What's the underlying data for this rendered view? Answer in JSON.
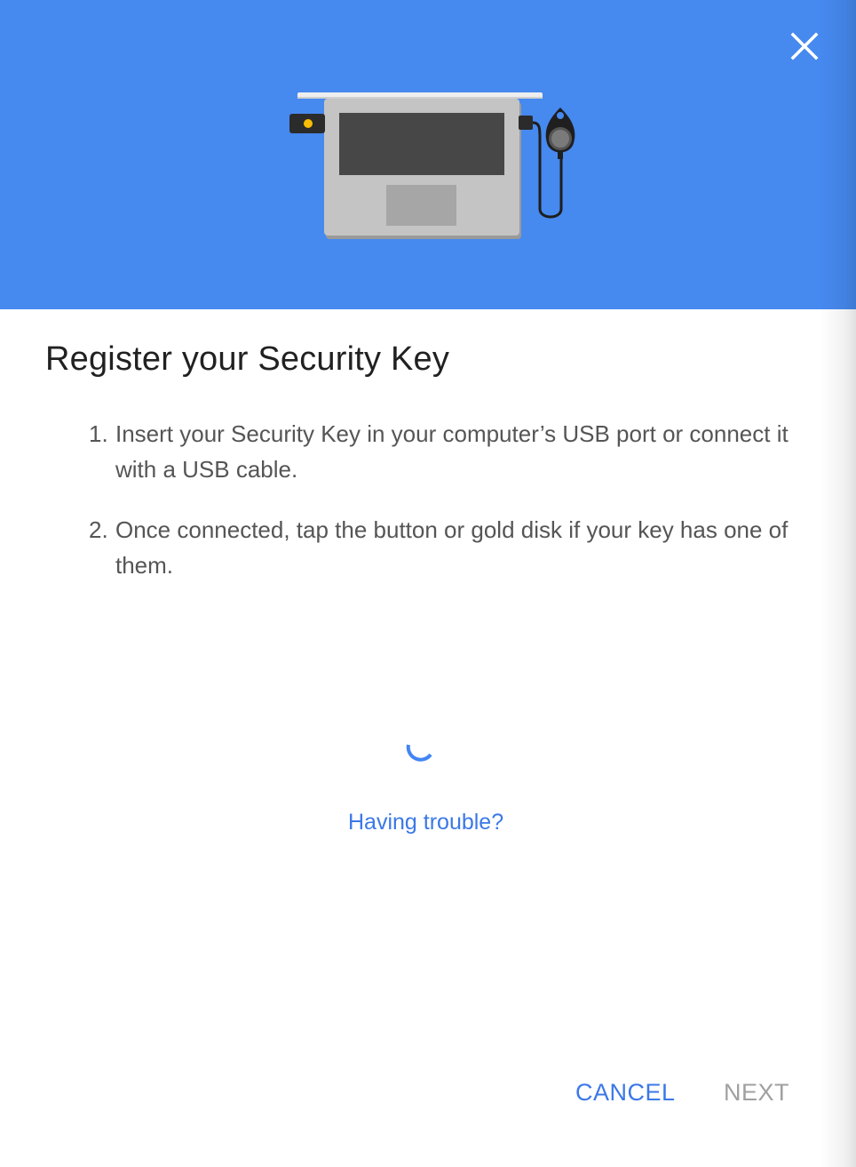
{
  "dialog": {
    "title": "Register your Security Key",
    "steps": [
      {
        "number": "1.",
        "text": "Insert your Security Key in your computer’s USB port or connect it with a USB cable."
      },
      {
        "number": "2.",
        "text": "Once connected, tap the button or gold disk if your key has one of them."
      }
    ],
    "trouble_link": "Having trouble?",
    "buttons": {
      "cancel": "CANCEL",
      "next": "NEXT"
    }
  },
  "icons": {
    "close": "close-icon",
    "illustration": "laptop-security-key-illustration",
    "spinner": "loading-spinner-icon"
  },
  "colors": {
    "header_bg": "#4689ef",
    "accent": "#3b78e7",
    "disabled": "#a0a0a0",
    "title": "#212121",
    "body_text": "#555555"
  }
}
